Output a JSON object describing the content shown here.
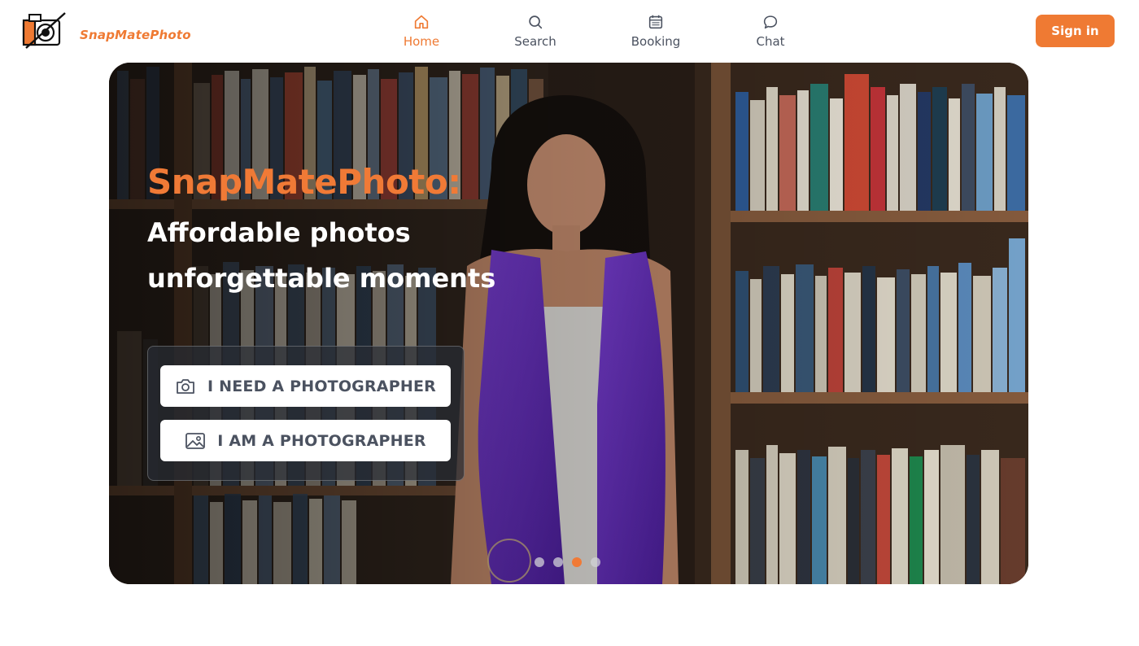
{
  "brand": {
    "name": "SnapMatePhoto",
    "accent_color": "#ef7a33"
  },
  "nav": {
    "items": [
      {
        "label": "Home",
        "icon": "home-icon",
        "active": true
      },
      {
        "label": "Search",
        "icon": "search-icon",
        "active": false
      },
      {
        "label": "Booking",
        "icon": "calendar-icon",
        "active": false
      },
      {
        "label": "Chat",
        "icon": "chat-bubble-icon",
        "active": false
      }
    ]
  },
  "header": {
    "signin_label": "Sign in"
  },
  "hero": {
    "title": "SnapMatePhoto:",
    "line1": "Affordable photos",
    "line2": "unforgettable moments",
    "cta_need": {
      "label": "I NEED A PHOTOGRAPHER",
      "icon": "camera-icon"
    },
    "cta_am": {
      "label": "I AM A PHOTOGRAPHER",
      "icon": "image-icon"
    },
    "carousel": {
      "slide_count": 4,
      "active_index": 2
    }
  }
}
